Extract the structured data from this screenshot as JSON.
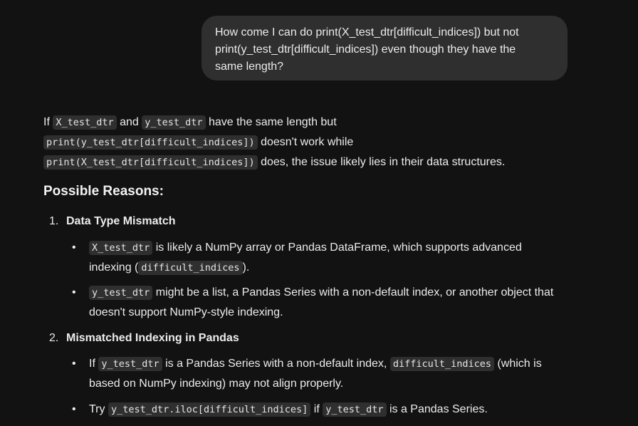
{
  "user_message": {
    "line1": "How come I can do print(X_test_dtr[difficult_indices]) but not",
    "line2": "print(y_test_dtr[difficult_indices]) even though they have the",
    "line3": "same length?"
  },
  "intro": {
    "p1_prefix": "If",
    "p1_code1": "X_test_dtr",
    "p1_and": "and",
    "p1_code2": "y_test_dtr",
    "p1_suffix": "have the same length but",
    "p2_code": "print(y_test_dtr[difficult_indices])",
    "p2_suffix": "doesn't work while",
    "p3_code": "print(X_test_dtr[difficult_indices])",
    "p3_suffix": "does, the issue likely lies in their data structures."
  },
  "section_heading": "Possible Reasons:",
  "reasons": [
    {
      "number": "1.",
      "title": "Data Type Mismatch",
      "bullets": [
        {
          "dot": "•",
          "code1": "X_test_dtr",
          "text1": "is likely a NumPy array or Pandas DataFrame, which supports advanced",
          "text2": "indexing (",
          "code2": "difficult_indices",
          "text3": ")."
        },
        {
          "dot": "•",
          "code1": "y_test_dtr",
          "text1": "might be a list, a Pandas Series with a non-default index, or another object that",
          "text2": "doesn't support NumPy-style indexing."
        }
      ]
    },
    {
      "number": "2.",
      "title": "Mismatched Indexing in Pandas",
      "bullets": [
        {
          "dot": "•",
          "prefix": "If",
          "code1": "y_test_dtr",
          "text1": "is a Pandas Series with a non-default index,",
          "code2": "difficult_indices",
          "text2": "(which is",
          "text3": "based on NumPy indexing) may not align properly."
        },
        {
          "dot": "•",
          "prefix": "Try",
          "code1": "y_test_dtr.iloc[difficult_indices]",
          "text1": "if",
          "code2": "y_test_dtr",
          "text2": "is a Pandas Series."
        }
      ]
    }
  ]
}
